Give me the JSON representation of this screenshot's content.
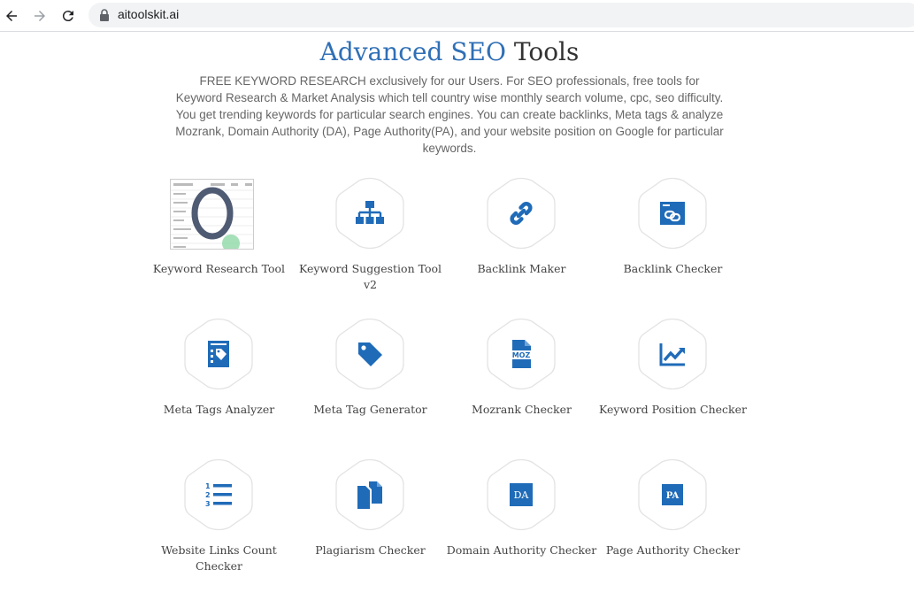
{
  "browser": {
    "url": "aitoolskit.ai"
  },
  "header": {
    "title_accent": "Advanced SEO",
    "title_rest": "Tools",
    "intro": "FREE KEYWORD RESEARCH exclusively for our Users. For SEO professionals, free tools for Keyword Research & Market Analysis which tell country wise monthly search volume, cpc, seo difficulty. You get trending keywords for particular search engines. You can create backlinks, Meta tags & analyze Mozrank, Domain Authority (DA), Page Authority(PA), and your website position on Google for particular keywords."
  },
  "colors": {
    "accent": "#2f6fb6",
    "icon": "#1f6bb8",
    "hex_border": "#e3e3e3"
  },
  "tools": [
    {
      "label": "Keyword Research Tool",
      "icon": "keyword-research-thumbnail"
    },
    {
      "label": "Keyword Suggestion Tool v2",
      "icon": "sitemap-icon"
    },
    {
      "label": "Backlink Maker",
      "icon": "link-icon"
    },
    {
      "label": "Backlink Checker",
      "icon": "browser-link-icon"
    },
    {
      "label": "Meta Tags Analyzer",
      "icon": "tag-document-icon"
    },
    {
      "label": "Meta Tag Generator",
      "icon": "tag-icon"
    },
    {
      "label": "Mozrank Checker",
      "icon": "moz-file-icon"
    },
    {
      "label": "Keyword Position Checker",
      "icon": "trend-chart-icon"
    },
    {
      "label": "Website Links Count Checker",
      "icon": "numbered-list-icon"
    },
    {
      "label": "Plagiarism Checker",
      "icon": "copy-documents-icon"
    },
    {
      "label": "Domain Authority Checker",
      "icon": "da-badge-icon"
    },
    {
      "label": "Page Authority Checker",
      "icon": "pa-badge-icon"
    }
  ],
  "badges": {
    "moz": "MOZ",
    "da": "DA",
    "pa": "PA"
  }
}
